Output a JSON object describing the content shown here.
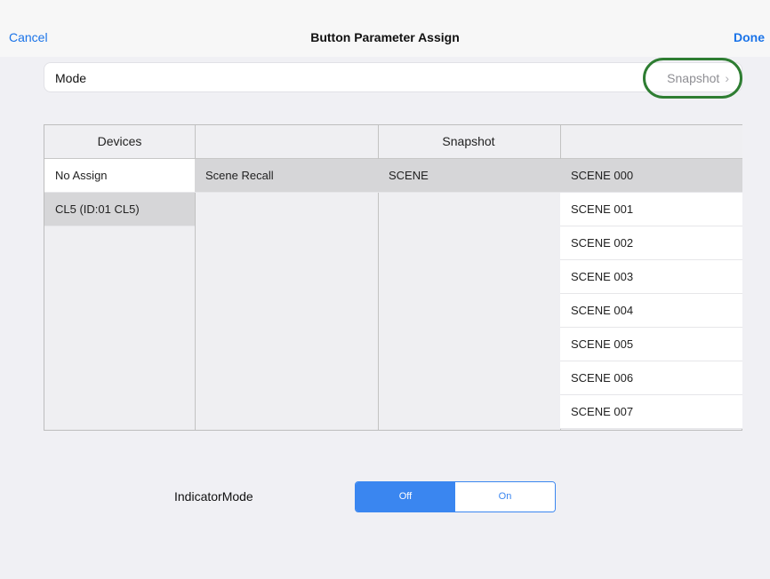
{
  "nav": {
    "cancel": "Cancel",
    "title": "Button Parameter Assign",
    "done": "Done"
  },
  "mode": {
    "label": "Mode",
    "value": "Snapshot",
    "chevron": "›"
  },
  "table": {
    "headers": {
      "devices": "Devices",
      "snapshot": "Snapshot"
    },
    "devices": [
      {
        "label": "No Assign",
        "state": "white"
      },
      {
        "label": "CL5 (ID:01 CL5)",
        "state": "selected"
      }
    ],
    "category": {
      "label": "Scene Recall",
      "state": "selected"
    },
    "type": {
      "label": "SCENE",
      "state": "selected"
    },
    "scenes": [
      {
        "label": "SCENE 000",
        "state": "selected"
      },
      {
        "label": "SCENE 001",
        "state": "white"
      },
      {
        "label": "SCENE 002",
        "state": "white"
      },
      {
        "label": "SCENE 003",
        "state": "white"
      },
      {
        "label": "SCENE 004",
        "state": "white"
      },
      {
        "label": "SCENE 005",
        "state": "white"
      },
      {
        "label": "SCENE 006",
        "state": "white"
      },
      {
        "label": "SCENE 007",
        "state": "white"
      }
    ]
  },
  "indicator": {
    "label": "IndicatorMode",
    "options": [
      "Off",
      "On"
    ],
    "selected": "Off"
  },
  "colors": {
    "accent": "#3a86f0",
    "highlight_ring": "#2e7d32"
  }
}
